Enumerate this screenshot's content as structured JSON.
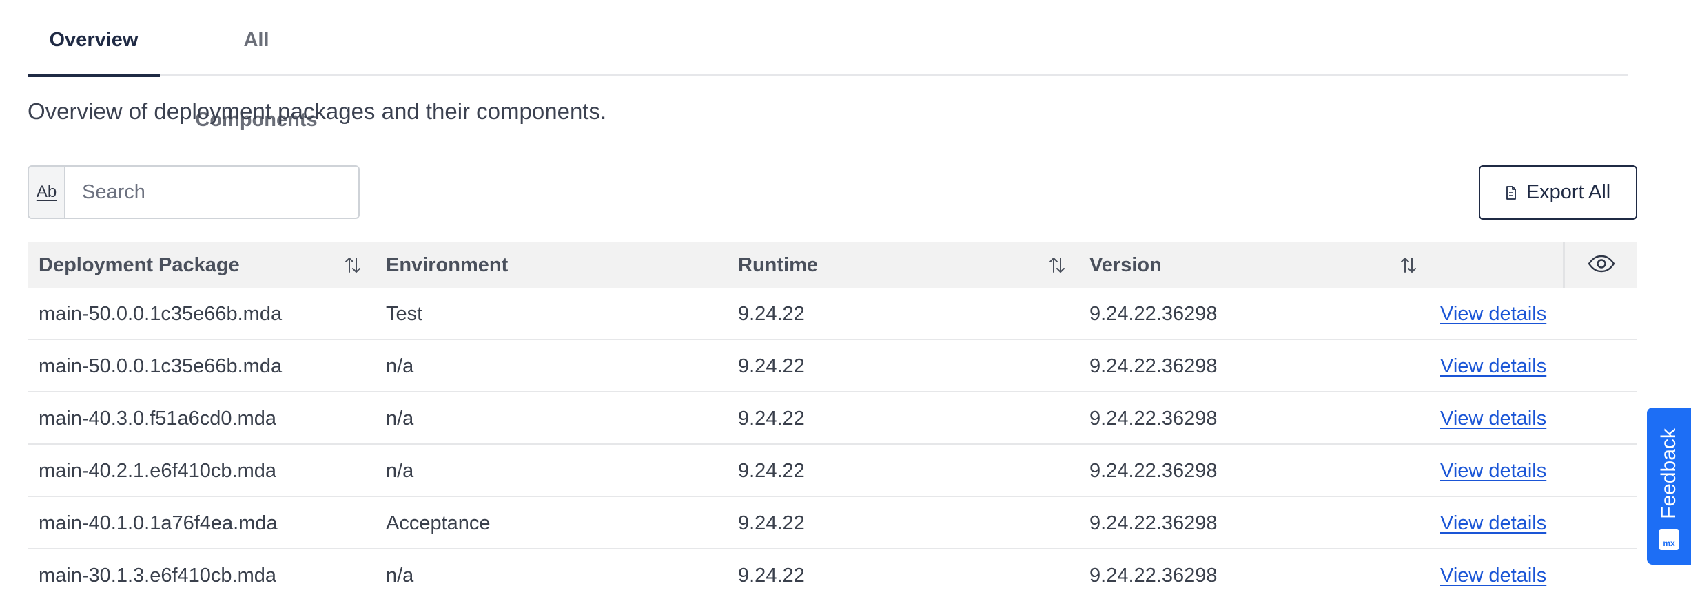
{
  "tabs": [
    {
      "label": "Overview",
      "active": true
    },
    {
      "label": "All Components",
      "active": false
    }
  ],
  "description": "Overview of deployment packages and their components.",
  "search": {
    "prefix_label": "Ab",
    "placeholder": "Search",
    "value": ""
  },
  "export": {
    "label": "Export All",
    "icon": "document-icon"
  },
  "table": {
    "columns": [
      {
        "label": "Deployment Package",
        "sortable": true
      },
      {
        "label": "Environment",
        "sortable": false
      },
      {
        "label": "Runtime",
        "sortable": true
      },
      {
        "label": "Version",
        "sortable": true
      }
    ],
    "column_visibility_icon": "eye-icon",
    "rows": [
      {
        "package": "main-50.0.0.1c35e66b.mda",
        "environment": "Test",
        "runtime": "9.24.22",
        "version": "9.24.22.36298",
        "action": "View details"
      },
      {
        "package": "main-50.0.0.1c35e66b.mda",
        "environment": "n/a",
        "runtime": "9.24.22",
        "version": "9.24.22.36298",
        "action": "View details"
      },
      {
        "package": "main-40.3.0.f51a6cd0.mda",
        "environment": "n/a",
        "runtime": "9.24.22",
        "version": "9.24.22.36298",
        "action": "View details"
      },
      {
        "package": "main-40.2.1.e6f410cb.mda",
        "environment": "n/a",
        "runtime": "9.24.22",
        "version": "9.24.22.36298",
        "action": "View details"
      },
      {
        "package": "main-40.1.0.1a76f4ea.mda",
        "environment": "Acceptance",
        "runtime": "9.24.22",
        "version": "9.24.22.36298",
        "action": "View details"
      },
      {
        "package": "main-30.1.3.e6f410cb.mda",
        "environment": "n/a",
        "runtime": "9.24.22",
        "version": "9.24.22.36298",
        "action": "View details"
      }
    ]
  },
  "feedback": {
    "label": "Feedback",
    "logo_text": "mx"
  },
  "colors": {
    "primary_text": "#1f2a44",
    "link": "#1a55d6",
    "header_bg": "#f2f2f2",
    "feedback_bg": "#1d6ef5"
  }
}
